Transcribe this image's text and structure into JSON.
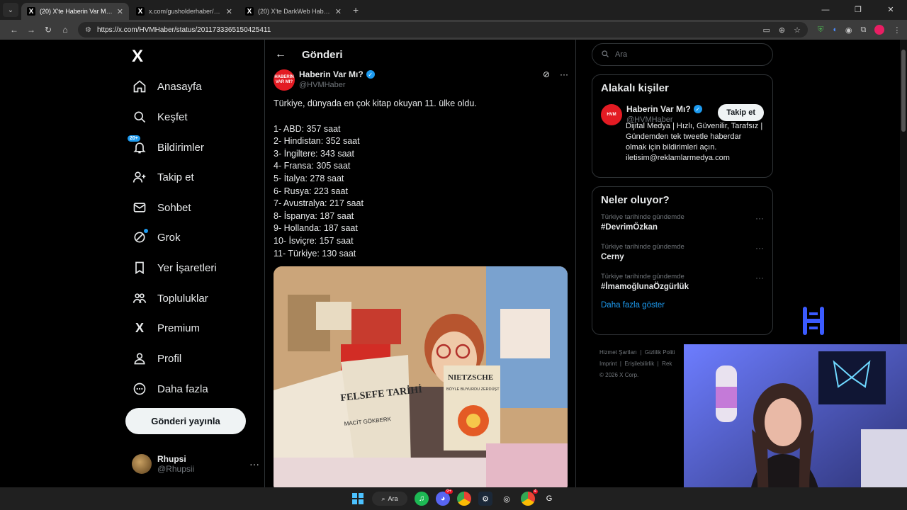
{
  "browser": {
    "tabs": [
      {
        "title": "(20) X'te Haberin Var Mı?: \"Türk",
        "active": true
      },
      {
        "title": "x.com/gusholderhaber/status/2",
        "active": false
      },
      {
        "title": "(20) X'te DarkWeb Haber: \"Saku",
        "active": false
      }
    ],
    "new_tab": "+",
    "url": "https://x.com/HVMHaber/status/2011733365150425411"
  },
  "nav": {
    "logo": "X",
    "items": [
      {
        "label": "Anasayfa",
        "icon": "home-icon"
      },
      {
        "label": "Keşfet",
        "icon": "search-icon"
      },
      {
        "label": "Bildirimler",
        "icon": "bell-icon",
        "badge": "20+"
      },
      {
        "label": "Takip et",
        "icon": "follow-icon"
      },
      {
        "label": "Sohbet",
        "icon": "mail-icon"
      },
      {
        "label": "Grok",
        "icon": "grok-icon"
      },
      {
        "label": "Yer İşaretleri",
        "icon": "bookmark-icon"
      },
      {
        "label": "Topluluklar",
        "icon": "communities-icon"
      },
      {
        "label": "Premium",
        "icon": "x-icon"
      },
      {
        "label": "Profil",
        "icon": "profile-icon"
      },
      {
        "label": "Daha fazla",
        "icon": "more-icon"
      }
    ],
    "post_button": "Gönderi yayınla",
    "account": {
      "name": "Rhupsi",
      "handle": "@Rhupsii"
    }
  },
  "post": {
    "header": "Gönderi",
    "author": {
      "name": "Haberin Var Mı?",
      "handle": "@HVMHaber",
      "avatar_text": "HABERİN VAR MI?"
    },
    "headline": "Türkiye, dünyada en çok kitap okuyan 11. ülke oldu.",
    "list": [
      "1- ABD: 357 saat",
      "2- Hindistan: 352 saat",
      "3- İngiltere: 343 saat",
      "4- Fransa: 305 saat",
      "5- İtalya: 278 saat",
      "6- Rusya: 223 saat",
      "7- Avustralya: 217 saat",
      "8- İspanya: 187 saat",
      "9- Hollanda: 187 saat",
      "10- İsviçre: 157 saat",
      "11- Türkiye: 130 saat"
    ],
    "media_books": {
      "book1": "FELSEFE TARİHİ",
      "book1_author": "MACİT GÖKBERK",
      "book2": "NIETZSCHE",
      "book2_sub": "BÖYLE BUYURDU ZERDÜŞT"
    }
  },
  "right": {
    "search_placeholder": "Ara",
    "related": {
      "title": "Alakalı kişiler",
      "name": "Haberin Var Mı?",
      "handle": "@HVMHaber",
      "follow": "Takip et",
      "bio": "Dijital Medya | Hızlı, Güvenilir, Tarafsız | Gündemden tek tweetle haberdar olmak için bildirimleri açın. iletisim@reklamlarmedya.com"
    },
    "trends": {
      "title": "Neler oluyor?",
      "items": [
        {
          "sub": "Türkiye tarihinde gündemde",
          "tag": "#DevrimÖzkan"
        },
        {
          "sub": "Türkiye tarihinde gündemde",
          "tag": "Cerny"
        },
        {
          "sub": "Türkiye tarihinde gündemde",
          "tag": "#İmamoğlunaÖzgürlük"
        }
      ],
      "show_more": "Daha fazla göster"
    },
    "footer": [
      "Hizmet Şartları",
      "Gizlilik Politi",
      "Imprint",
      "Erişilebilirlik",
      "Rek",
      "© 2026 X Corp."
    ]
  },
  "taskbar": {
    "search": "Ara",
    "discord_badge": "9+",
    "chrome_badge": "4"
  }
}
